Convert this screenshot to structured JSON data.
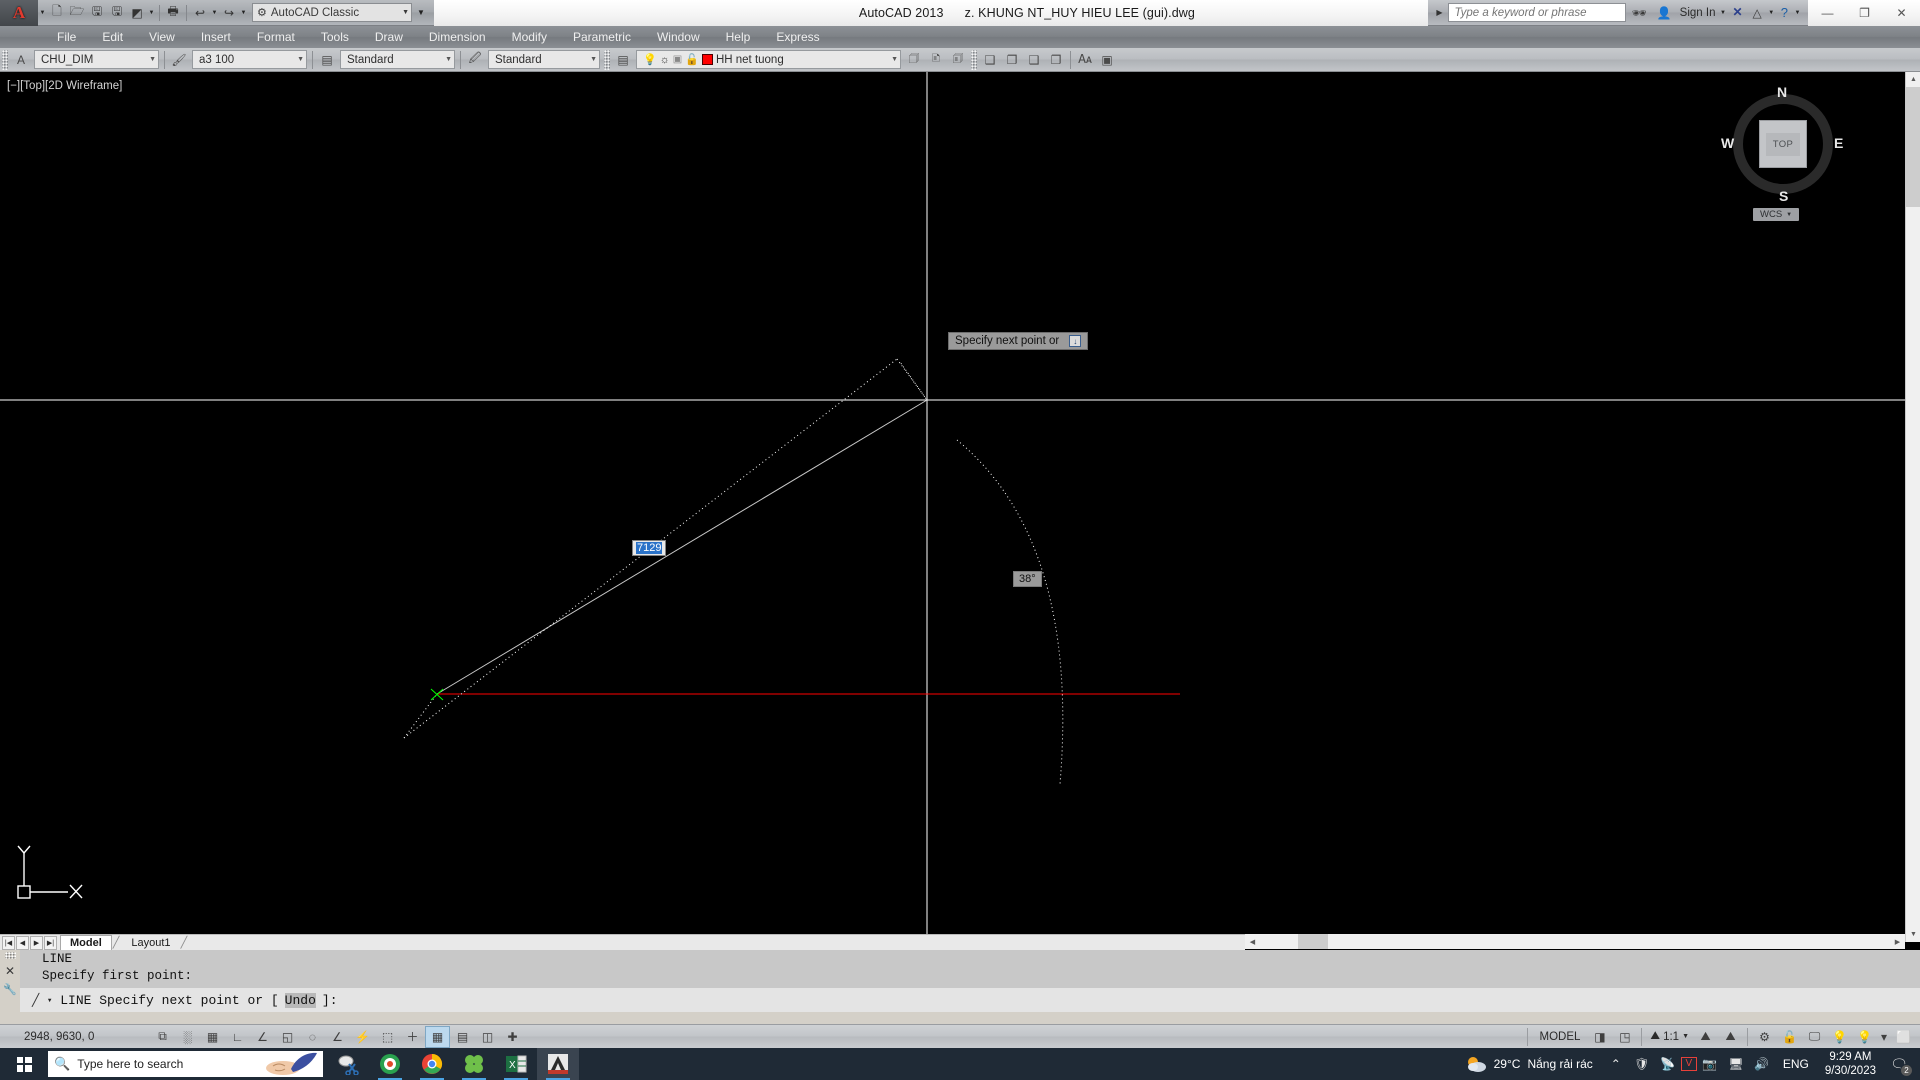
{
  "titlebar": {
    "app_title": "AutoCAD 2013",
    "document_title": "z. KHUNG NT_HUY HIEU LEE (gui).dwg",
    "workspace": "AutoCAD Classic",
    "quick_access": [
      {
        "name": "new",
        "glyph": "⬜"
      },
      {
        "name": "open",
        "glyph": "📂"
      },
      {
        "name": "save",
        "glyph": "💾"
      },
      {
        "name": "saveas",
        "glyph": "🖫"
      },
      {
        "name": "plot-preview",
        "glyph": "◧"
      },
      {
        "name": "plot",
        "glyph": "🖨"
      },
      {
        "name": "undo",
        "glyph": "↩"
      },
      {
        "name": "redo",
        "glyph": "↪"
      }
    ],
    "search_placeholder": "Type a keyword or phrase",
    "sign_in": "Sign In",
    "window_buttons": {
      "minimize": "—",
      "restore": "❐",
      "close": "✕"
    }
  },
  "menubar": {
    "items": [
      "File",
      "Edit",
      "View",
      "Insert",
      "Format",
      "Tools",
      "Draw",
      "Dimension",
      "Modify",
      "Parametric",
      "Window",
      "Help",
      "Express"
    ]
  },
  "toolbar": {
    "text_style": "CHU_DIM",
    "dim_style": "a3 100",
    "table_style": "Standard",
    "multileader_style": "Standard",
    "layer_name": "HH net tuong",
    "layer_color": "#ff0000"
  },
  "canvas": {
    "viewport_label": "[−][Top][2D Wireframe]",
    "background": "#000000",
    "viewcube": {
      "face": "TOP",
      "north": "N",
      "east": "E",
      "south": "S",
      "west": "W",
      "ucs_label": "WCS"
    },
    "tooltip": {
      "text": "Specify next point or",
      "key_hint": "↓"
    },
    "dim_distance": "7129",
    "dim_angle": "38°"
  },
  "layout_tabs": {
    "tabs": [
      {
        "label": "Model",
        "active": true
      },
      {
        "label": "Layout1",
        "active": false
      }
    ]
  },
  "command": {
    "history": [
      "LINE",
      "Specify first point:"
    ],
    "prompt_prefix": "LINE Specify next point or [",
    "prompt_keyword": "Undo",
    "prompt_suffix": "]:"
  },
  "statusbar": {
    "coordinates": "2948, 9630, 0",
    "toggles": [
      {
        "name": "snap-mode",
        "glyph": "⧉",
        "on": false
      },
      {
        "name": "grid-display",
        "glyph": "░",
        "on": false
      },
      {
        "name": "grid-mode",
        "glyph": "▦",
        "on": false
      },
      {
        "name": "ortho-mode",
        "glyph": "∟",
        "on": false
      },
      {
        "name": "polar-tracking",
        "glyph": "∠",
        "on": false
      },
      {
        "name": "object-snap",
        "glyph": "◱",
        "on": false
      },
      {
        "name": "osnap-tracking",
        "glyph": "◌",
        "on": false
      },
      {
        "name": "allow-ucs",
        "glyph": "∠",
        "on": false
      },
      {
        "name": "dynamic-ucs",
        "glyph": "⚡",
        "on": false
      },
      {
        "name": "dynamic-input",
        "glyph": "⬚",
        "on": false
      },
      {
        "name": "lineweight",
        "glyph": "＋",
        "on": false
      },
      {
        "name": "transparency",
        "glyph": "▦",
        "on": true
      },
      {
        "name": "quick-properties",
        "glyph": "▤",
        "on": false
      },
      {
        "name": "selection-cycling",
        "glyph": "◫",
        "on": false
      },
      {
        "name": "annotation-monitor",
        "glyph": "✚",
        "on": false
      }
    ],
    "space": "MODEL",
    "scale": "1:1",
    "right_icons": [
      {
        "name": "layout-viewport",
        "glyph": "◨"
      },
      {
        "name": "dual-viewport",
        "glyph": "◳"
      },
      {
        "name": "annotation-scale",
        "glyph": "⛰"
      },
      {
        "name": "annotation-visibility",
        "glyph": "⛰"
      },
      {
        "name": "auto-scale",
        "glyph": "⛰"
      },
      {
        "name": "workspace-switch",
        "glyph": "⚙"
      },
      {
        "name": "toolbar-lock",
        "glyph": "🔓"
      },
      {
        "name": "hardware-accel",
        "glyph": "🖵"
      },
      {
        "name": "isolate-objects",
        "glyph": "💡"
      },
      {
        "name": "status-menu",
        "glyph": "▾"
      },
      {
        "name": "clean-screen",
        "glyph": "⬜"
      }
    ]
  },
  "taskbar": {
    "search_placeholder": "Type here to search",
    "apps": [
      {
        "name": "snipping-tool",
        "active": false
      },
      {
        "name": "recording-app",
        "active": false
      },
      {
        "name": "google-chrome",
        "active": false
      },
      {
        "name": "clover-app",
        "active": false
      },
      {
        "name": "microsoft-excel",
        "active": false
      },
      {
        "name": "autocad",
        "active": true
      }
    ],
    "weather_temp": "29°C",
    "weather_desc": "Nắng rải rác",
    "language": "ENG",
    "time": "9:29 AM",
    "date": "9/30/2023",
    "notification_count": "2"
  }
}
